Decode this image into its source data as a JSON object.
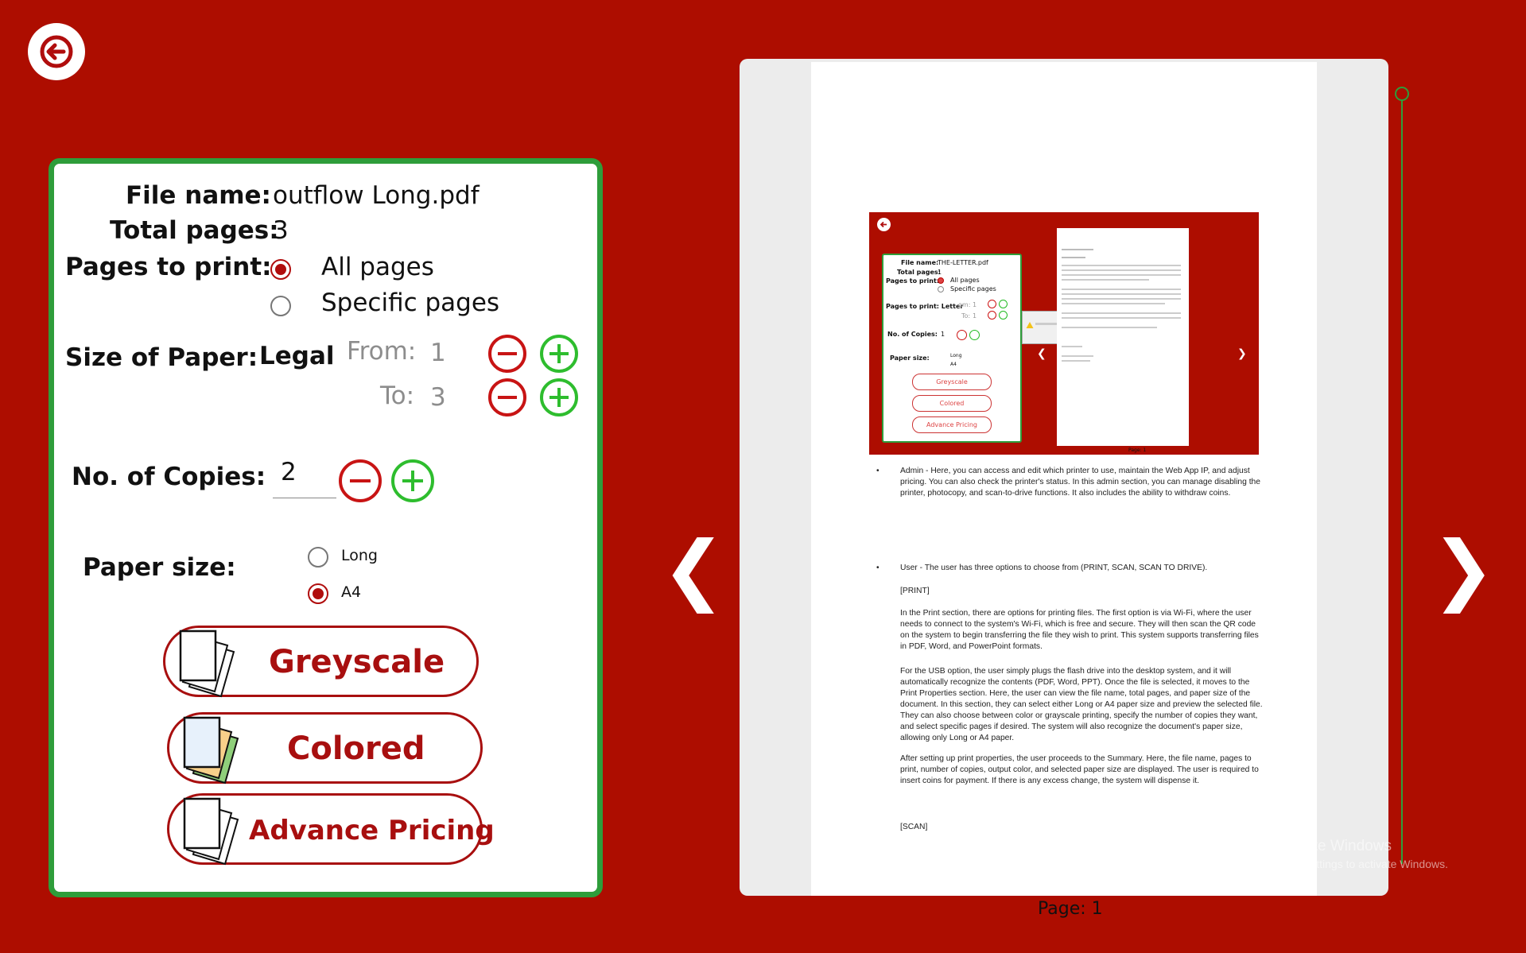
{
  "back_button": {
    "icon": "arrow-left-icon"
  },
  "print_settings": {
    "file_name_label": "File name:",
    "file_name_value": "outflow Long.pdf",
    "total_pages_label": "Total pages:",
    "total_pages_value": "3",
    "pages_to_print_label": "Pages to print:",
    "pages_option_all": "All pages",
    "pages_option_specific": "Specific pages",
    "pages_selected": "All pages",
    "size_of_paper_label": "Size of Paper:",
    "size_of_paper_value": "Legal",
    "from_label": "From:",
    "from_value": "1",
    "to_label": "To:",
    "to_value": "3",
    "copies_label": "No. of Copies:",
    "copies_value": "2",
    "paper_size_label": "Paper size:",
    "paper_option_long": "Long",
    "paper_option_a4": "A4",
    "paper_selected": "A4",
    "greyscale_label": "Greyscale",
    "colored_label": "Colored",
    "advance_pricing_label": "Advance Pricing"
  },
  "preview": {
    "page_indicator": "Page: 1",
    "prev_arrow": "❮",
    "next_arrow": "❯",
    "document": {
      "screenshot": {
        "file_name_label": "File name:",
        "file_name_value": "THE-LETTER.pdf",
        "total_pages_label": "Total pages:",
        "total_pages_value": "1",
        "pages_to_print_label": "Pages to print:",
        "all_pages": "All pages",
        "specific_pages": "Specific pages",
        "size_label": "Pages to print: Letter",
        "from_label": "om:",
        "from_value": "1",
        "to_label": "To:",
        "to_value": "1",
        "copies_label": "No. of Copies:",
        "copies_value": "1",
        "paper_size_label": "Paper size:",
        "long": "Long",
        "a4": "A4",
        "greyscale": "Greyscale",
        "colored": "Colored",
        "advance_pricing": "Advance Pricing",
        "page_label": "Page: 1"
      },
      "bullet_admin": "Admin - Here, you can access and edit which printer to use, maintain the Web App IP, and adjust pricing. You can also check the printer's status. In this admin section, you can manage disabling the printer, photocopy, and scan-to-drive functions. It also includes the ability to withdraw coins.",
      "bullet_user": "User - The user has three options to choose from (PRINT, SCAN, SCAN TO DRIVE).",
      "print_heading": "[PRINT]",
      "para_wifi": "In the Print section, there are options for printing files. The first option is via Wi-Fi, where the user needs to connect to the system's Wi-Fi, which is free and secure. They will then scan the QR code on the system to begin transferring the file they wish to print. This system supports transferring files in PDF, Word, and PowerPoint formats.",
      "para_usb": "For the USB option, the user simply plugs the flash drive into the desktop system, and it will automatically recognize the contents (PDF, Word, PPT). Once the file is selected, it moves to the Print Properties section. Here, the user can view the file name, total pages, and paper size of the document. In this section, they can select either Long or A4 paper size and preview the selected file. They can also choose between color or grayscale printing, specify the number of copies they want, and select specific pages if desired. The system will also recognize the document's paper size, allowing only Long or A4 paper.",
      "para_summary": "After setting up print properties, the user proceeds to the Summary. Here, the file name, pages to print, number of copies, output color, and selected paper size are displayed. The user is required to insert coins for payment. If there is any excess change, the system will dispense it.",
      "scan_heading": "[SCAN]"
    }
  },
  "watermark": {
    "title": "Activate Windows",
    "subtitle": "Go to Settings to activate Windows."
  },
  "colors": {
    "background": "#ad0d00",
    "accent_green": "#2e9d3a",
    "accent_red": "#a80f0f"
  }
}
